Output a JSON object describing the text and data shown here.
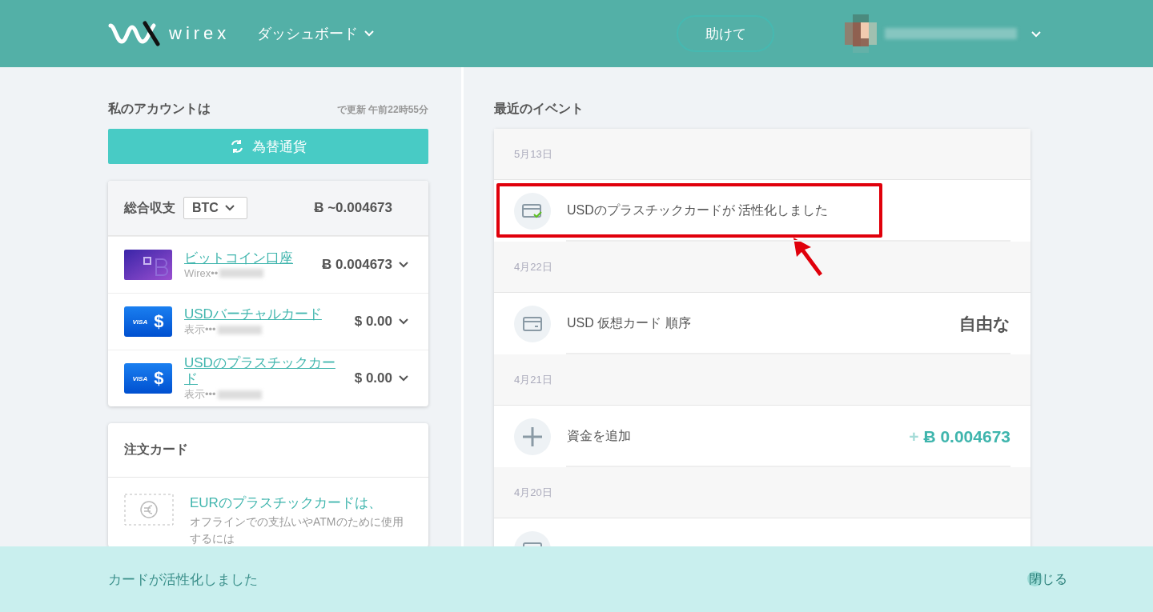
{
  "header": {
    "logo": "wirex",
    "nav": "ダッシュボード",
    "help": "助けて"
  },
  "accounts": {
    "title": "私のアカウントは",
    "updated": "で更新 午前22時55分",
    "exchange_button": "為替通貨",
    "balance_label": "総合収支",
    "currency": "BTC",
    "total": "Ƀ ~0.004673",
    "items": [
      {
        "kind": "bitcoin",
        "name": "ビットコイン口座",
        "masked": "Wirex••",
        "balance": "Ƀ 0.004673"
      },
      {
        "kind": "visa",
        "brand": "VISA",
        "symbol": "$",
        "name": "USDバーチャルカード",
        "masked": "表示•••",
        "balance": "$ 0.00"
      },
      {
        "kind": "visa",
        "brand": "VISA",
        "symbol": "$",
        "name": "USDのプラスチックカード",
        "masked": "表示•••",
        "balance": "$ 0.00"
      }
    ]
  },
  "order_cards": {
    "title": "注文カード",
    "items": [
      {
        "title": "EURのプラスチックカードは、",
        "description": "オフラインでの支払いやATMのために使用するには"
      }
    ]
  },
  "events": {
    "title": "最近のイベント",
    "groups": [
      {
        "date": "5月13日",
        "items": [
          {
            "kind": "card-check",
            "text": "USDのプラスチックカードが 活性化しました",
            "highlighted": true
          }
        ]
      },
      {
        "date": "4月22日",
        "items": [
          {
            "kind": "card",
            "text": "USD 仮想カード 順序",
            "amount": "自由な",
            "highlighted": false
          }
        ]
      },
      {
        "date": "4月21日",
        "items": [
          {
            "kind": "plus",
            "text": "資金を追加",
            "sign": "+",
            "amount": "Ƀ 0.004673",
            "highlighted": false
          }
        ]
      },
      {
        "date": "4月20日",
        "items": [
          {
            "kind": "card",
            "highlighted": false
          }
        ]
      }
    ]
  },
  "banner": {
    "message": "カードが活性化しました",
    "close": "閉じる"
  }
}
